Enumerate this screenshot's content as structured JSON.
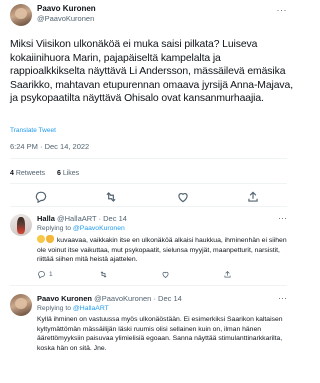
{
  "main_tweet": {
    "author_name": "Paavo Kuronen",
    "author_handle": "@PaavoKuronen",
    "text": "Miksi Viisikon ulkonäköä ei muka saisi pilkata? Luiseva kokaiinihuora Marin, pajapäiseltä kampelalta ja rappioalkkikselta näyttävä Li Andersson, mässäilevä emäsika Saarikko, mahtavan etupurennan omaava jyrsijä Anna-Majava, ja psykopaatilta näyttävä Ohisalo ovat kansanmurhaajia.",
    "translate_label": "Translate Tweet",
    "timestamp": "6:24 PM · Dec 14, 2022",
    "retweets_count": "4",
    "retweets_label": "Retweets",
    "likes_count": "6",
    "likes_label": "Likes"
  },
  "replies": [
    {
      "author_name": "Halla",
      "author_handle": "@HallaART",
      "date": "· Dec 14",
      "replying_prefix": "Replying to",
      "replying_to": "@PaavoKuronen",
      "text": "kuvaavaa, vaikkakin itse en ulkonäköä alkaisi haukkua, ihminenhän ei siihen ole voinut itse vaikuttaa, mut psykopaatit, sielunsa myyjät, maanpetturit, narsistit, riittää siihen mitä heistä ajattelen.",
      "reply_count": "1",
      "retweet_count": "",
      "like_count": "",
      "avatar_icon": "avatar-halla"
    },
    {
      "author_name": "Paavo Kuronen",
      "author_handle": "@PaavoKuronen",
      "date": "· Dec 14",
      "replying_prefix": "Replying to",
      "replying_to": "@HallaART",
      "text": "Kyllä ihminen on vastuussa myös ulkonäöstään. Ei esimerkiksi Saarikon kaltaisen kyltymättömän mässäilijän läski ruumis olisi sellainen kuin on, ilman hänen äärettömyyksiin paisuvaa ylimielisiä ego­aan. Sanna näyttää stimulanttinarkkarilta, koska hän on sitä. Jne.",
      "reply_count": "",
      "retweet_count": "",
      "like_count": "",
      "avatar_icon": "avatar-paavo"
    }
  ],
  "icons": {
    "more": "more-icon",
    "reply": "reply-icon",
    "retweet": "retweet-icon",
    "like": "like-icon",
    "share": "share-icon"
  },
  "colors": {
    "text": "#0f1419",
    "secondary": "#536471",
    "link": "#1d9bf0",
    "divider": "#eff3f4"
  }
}
